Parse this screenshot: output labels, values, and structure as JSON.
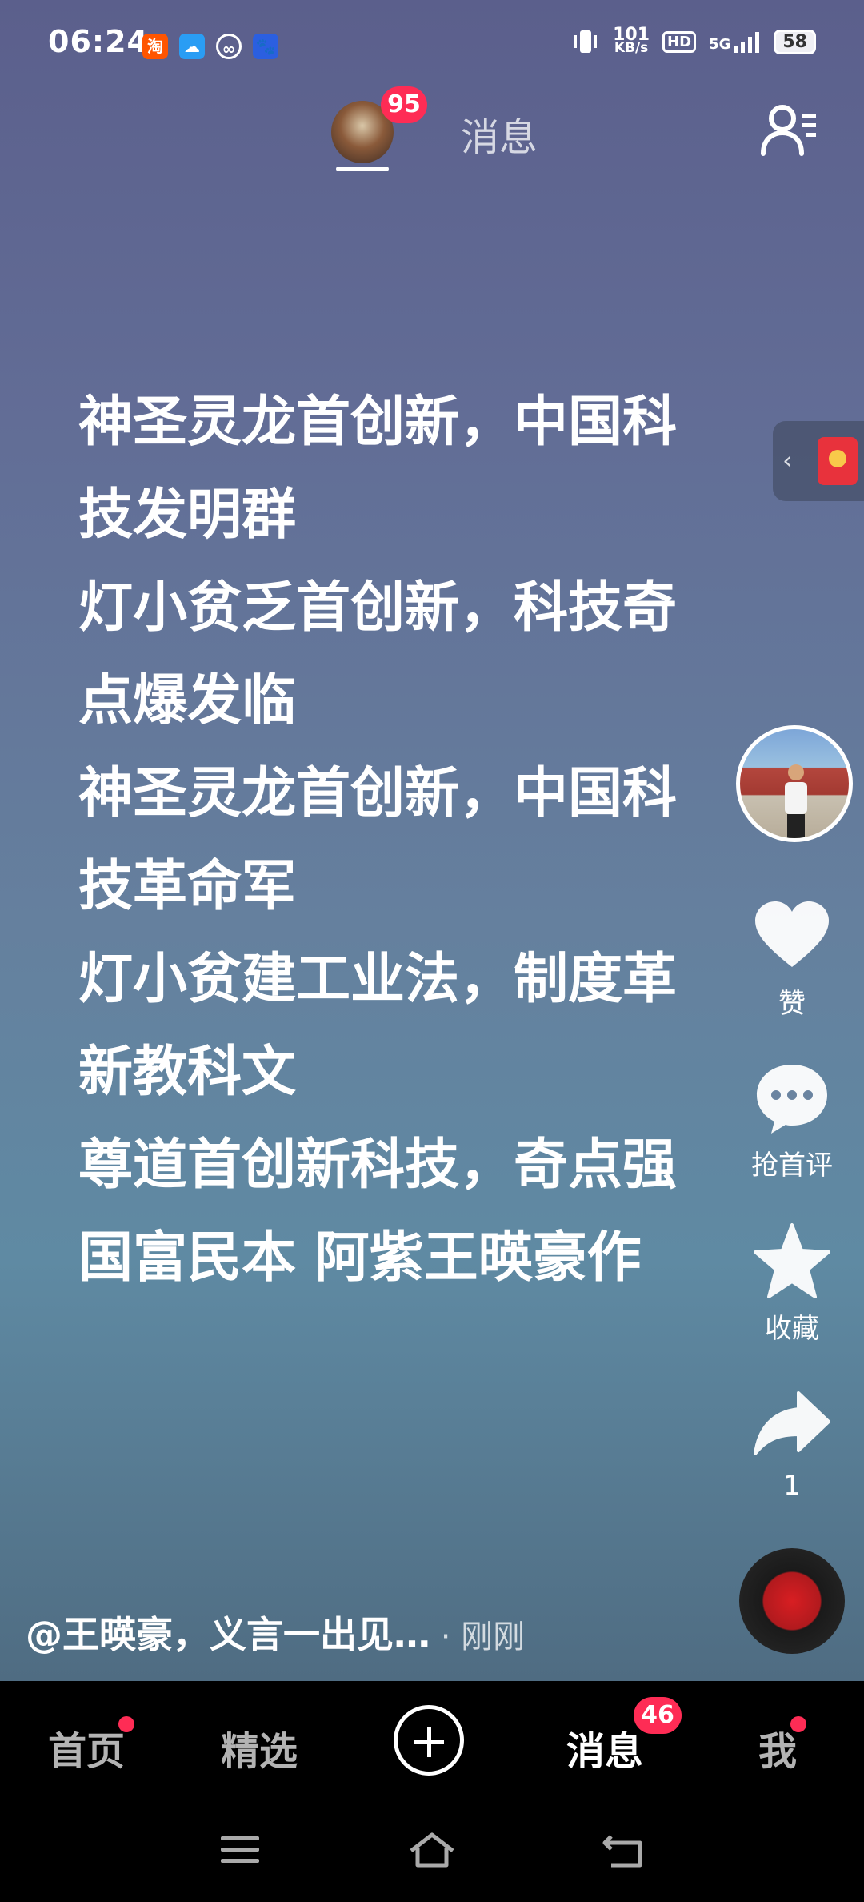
{
  "status": {
    "time": "06:24",
    "notification_icons": [
      "taobao-icon",
      "cloud-app-icon",
      "link-app-icon",
      "baidu-icon"
    ],
    "speed_value": "101",
    "speed_unit": "KB/s",
    "hd": "HD",
    "network": "5G",
    "battery": "58"
  },
  "header": {
    "avatar_badge": "95",
    "title": "消息"
  },
  "poem": {
    "lines": [
      "神圣灵龙首创新，中国科",
      "技发明群",
      "灯小贫乏首创新，科技奇",
      "点爆发临",
      "神圣灵龙首创新，中国科",
      "技革命军",
      "灯小贫建工业法，制度革",
      "新教科文",
      "尊道首创新科技，奇点强",
      "国富民本  阿紫王暎豪作"
    ]
  },
  "rail": {
    "like_label": "赞",
    "comment_label": "抢首评",
    "favorite_label": "收藏",
    "share_count": "1"
  },
  "caption": {
    "text": "@王暎豪，义言一出见…",
    "separator": " · ",
    "time": "刚刚"
  },
  "bottom_nav": {
    "home": "首页",
    "featured": "精选",
    "messages": "消息",
    "messages_badge": "46",
    "me": "我"
  },
  "colors": {
    "badge": "#fe2c55",
    "nav_background": "#000000"
  }
}
